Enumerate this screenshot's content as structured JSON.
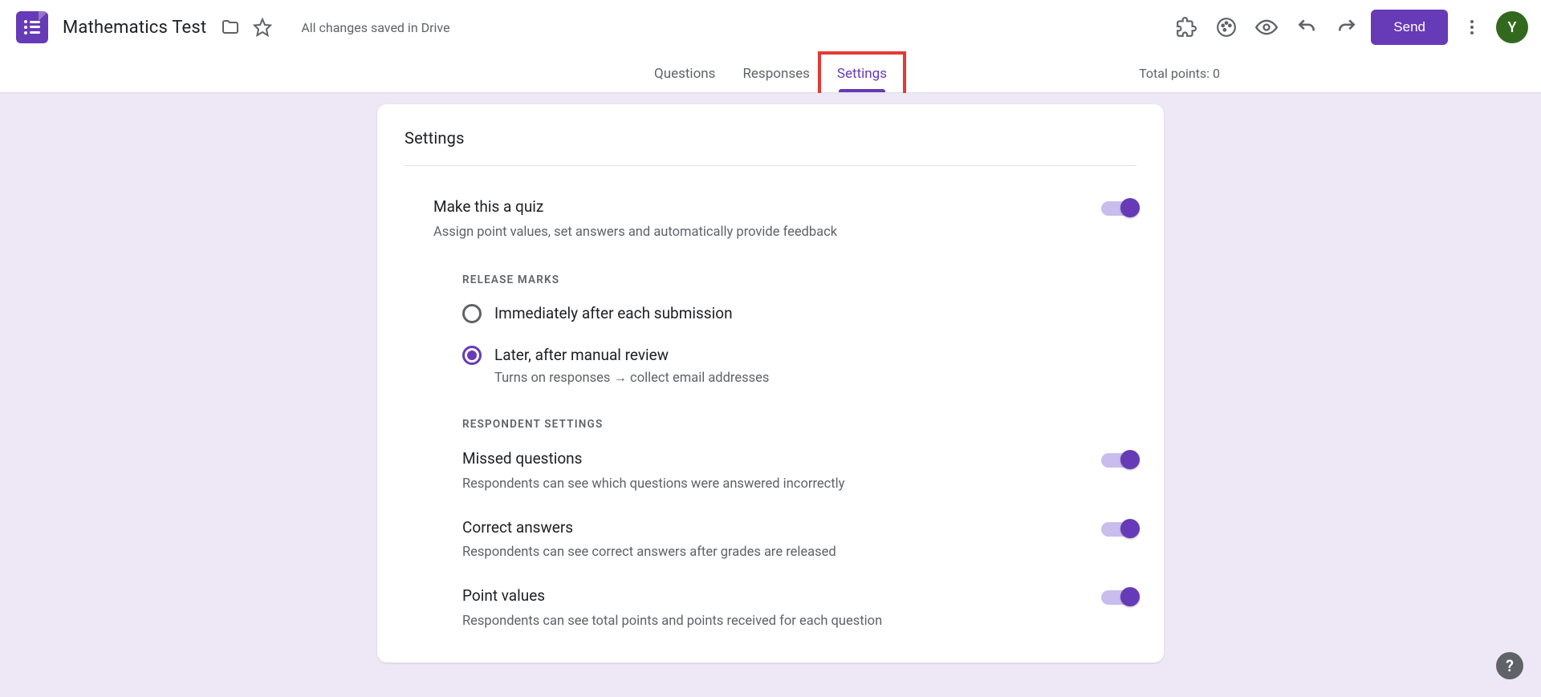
{
  "header": {
    "title": "Mathematics Test",
    "save_status": "All changes saved in Drive",
    "send_label": "Send",
    "avatar_initial": "Y"
  },
  "tabs": {
    "items": [
      "Questions",
      "Responses",
      "Settings"
    ],
    "active_index": 2,
    "total_points_label": "Total points: 0"
  },
  "settings": {
    "heading": "Settings",
    "quiz": {
      "title": "Make this a quiz",
      "desc": "Assign point values, set answers and automatically provide feedback",
      "on": true
    },
    "release_marks": {
      "heading": "RELEASE MARKS",
      "options": [
        {
          "label": "Immediately after each submission",
          "selected": false
        },
        {
          "label": "Later, after manual review",
          "sub": "Turns on responses → collect email addresses",
          "selected": true
        }
      ]
    },
    "respondent": {
      "heading": "RESPONDENT SETTINGS",
      "items": [
        {
          "title": "Missed questions",
          "desc": "Respondents can see which questions were answered incorrectly",
          "on": true
        },
        {
          "title": "Correct answers",
          "desc": "Respondents can see correct answers after grades are released",
          "on": true
        },
        {
          "title": "Point values",
          "desc": "Respondents can see total points and points received for each question",
          "on": true
        }
      ]
    }
  }
}
